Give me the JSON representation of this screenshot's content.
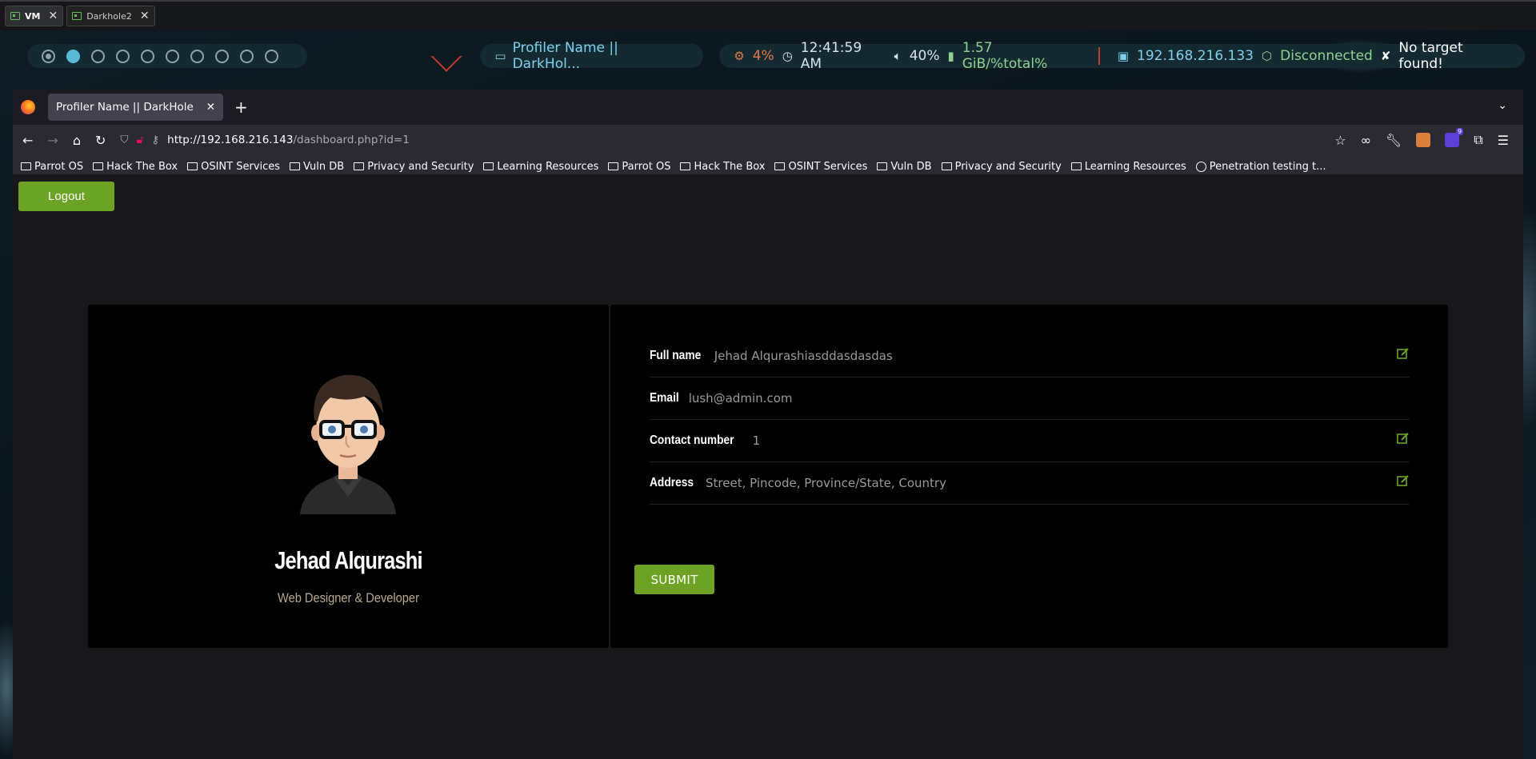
{
  "host_tabs": [
    {
      "label": "VM",
      "active": true
    },
    {
      "label": "Darkhole2",
      "active": false
    }
  ],
  "polybar": {
    "window_title": "Profiler Name || DarkHol...",
    "cpu": "4%",
    "clock": "12:41:59 AM",
    "volume": "40%",
    "memory": "1.57 GiB/%total%",
    "ip": "192.168.216.133",
    "vpn": "Disconnected",
    "target": "No target found!",
    "colors": {
      "cpu": "#e07a45",
      "cyan": "#7fd0ec",
      "green": "#8fd38b"
    }
  },
  "browser": {
    "tab_title": "Profiler Name || DarkHole",
    "url_host": "http://192.168.216.143",
    "url_path": "/dashboard.php?id=1",
    "bookmarks": [
      {
        "label": "Parrot OS",
        "icon": "folder-icon"
      },
      {
        "label": "Hack The Box",
        "icon": "folder-icon"
      },
      {
        "label": "OSINT Services",
        "icon": "folder-icon"
      },
      {
        "label": "Vuln DB",
        "icon": "folder-icon"
      },
      {
        "label": "Privacy and Security",
        "icon": "folder-icon"
      },
      {
        "label": "Learning Resources",
        "icon": "folder-icon"
      },
      {
        "label": "Parrot OS",
        "icon": "folder-icon"
      },
      {
        "label": "Hack The Box",
        "icon": "folder-icon"
      },
      {
        "label": "OSINT Services",
        "icon": "folder-icon"
      },
      {
        "label": "Vuln DB",
        "icon": "folder-icon"
      },
      {
        "label": "Privacy and Security",
        "icon": "folder-icon"
      },
      {
        "label": "Learning Resources",
        "icon": "folder-icon"
      },
      {
        "label": "Penetration testing t...",
        "icon": "globe-icon"
      }
    ],
    "extension_badge": "9"
  },
  "page": {
    "logout_label": "Logout",
    "profile": {
      "name": "Jehad Alqurashi",
      "role": "Web Designer & Developer"
    },
    "fields": [
      {
        "label": "Full name",
        "value": "Jehad Alqurashiasddasdasdas",
        "editable": true
      },
      {
        "label": "Email",
        "value": "lush@admin.com",
        "editable": false
      },
      {
        "label": "Contact number",
        "value": "1",
        "editable": true
      },
      {
        "label": "Address",
        "value": "Street, Pincode, Province/State, Country",
        "editable": true
      }
    ],
    "submit_label": "SUBMIT",
    "accent": "#6ca324"
  }
}
